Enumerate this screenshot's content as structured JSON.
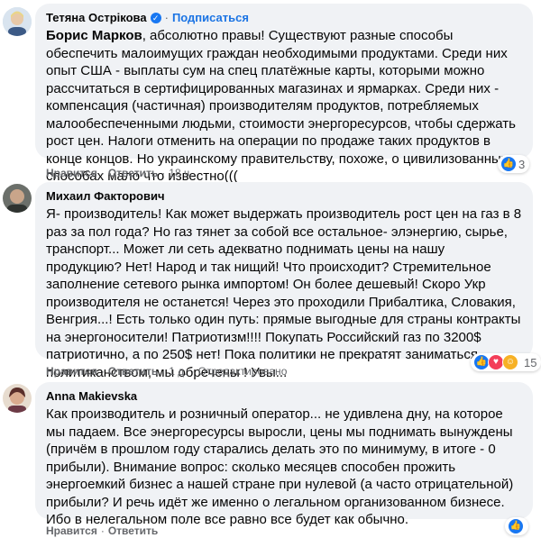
{
  "comments": [
    {
      "author": "Тетяна Острікова",
      "verified": true,
      "dot": "·",
      "subscribe": "Подписаться",
      "mention": "Борис Марков",
      "text": ", абсолютно правы! Существуют разные способы обеспечить малоимущих граждан необходимыми продуктами. Среди них опыт США - выплаты сум на спец платёжные карты, которыми можно рассчитаться в сертифицированных магазинах и ярмарках. Среди них - компенсация (частичная) производителям продуктов, потребляемых малообеспеченными людьми, стоимости энергоресурсов, чтобы сдержать рост цен. Налоги отменить на операции по продаже таких продуктов в конце концов. Но украинскому правительству, похоже, о цивилизованных способах мало что известно(((",
      "like": "Нравится",
      "reply": "Ответить",
      "time": "18 ч.",
      "reaction_count": "3",
      "reactions": [
        "like"
      ]
    },
    {
      "author": "Михаил Факторович",
      "text": "Я- производитель! Как может выдержать производитель рост цен на газ в 8 раз за пол года? Но газ тянет за собой все остальное- элэнергию, сырье, транспорт... Может ли сеть адекватно поднимать цены на нашу продукцию? Нет! Народ и так нищий! Что происходит? Стремительное заполнение сетевого рынка импортом! Он более дешевый! Скоро Укр производителя не останется! Через это проходили Прибалтика, Словакия, Венгрия...! Есть только один путь: прямые выгодные для страны контракты на энергоносители! Патриотизм!!!! Покупать Российский газ по 3200$ патриотично, а по 250$ нет! Пока политики не прекратят заниматься политиканством, мы обречены ! Увы...",
      "like": "Нравится",
      "reply": "Ответить",
      "time": "1 д.",
      "edited": "Отредактировано",
      "reaction_count": "15",
      "reactions": [
        "like",
        "love",
        "haha"
      ]
    },
    {
      "author": "Anna Makievska",
      "text": "Как производитель и розничный оператор... не удивлена дну, на которое мы падаем. Все энергоресурсы выросли, цены мы поднимать вынуждены (причём в прошлом году старались делать это по минимуму, в итоге - 0 прибыли). Внимание вопрос: сколько месяцев способен прожить энергоемкий бизнес а нашей стране при нулевой (а часто отрицательной) прибыли? И речь идёт же именно о легальном организованном бизнесе. Ибо в нелегальном поле все равно все будет как обычно.",
      "like": "Нравится",
      "reply": "Ответить",
      "reaction_count": "",
      "reactions": [
        "like"
      ]
    }
  ],
  "colors": {
    "bubble": "#f0f2f5",
    "link": "#1b74e4",
    "meta": "#65676b",
    "like": "#1877f2"
  }
}
